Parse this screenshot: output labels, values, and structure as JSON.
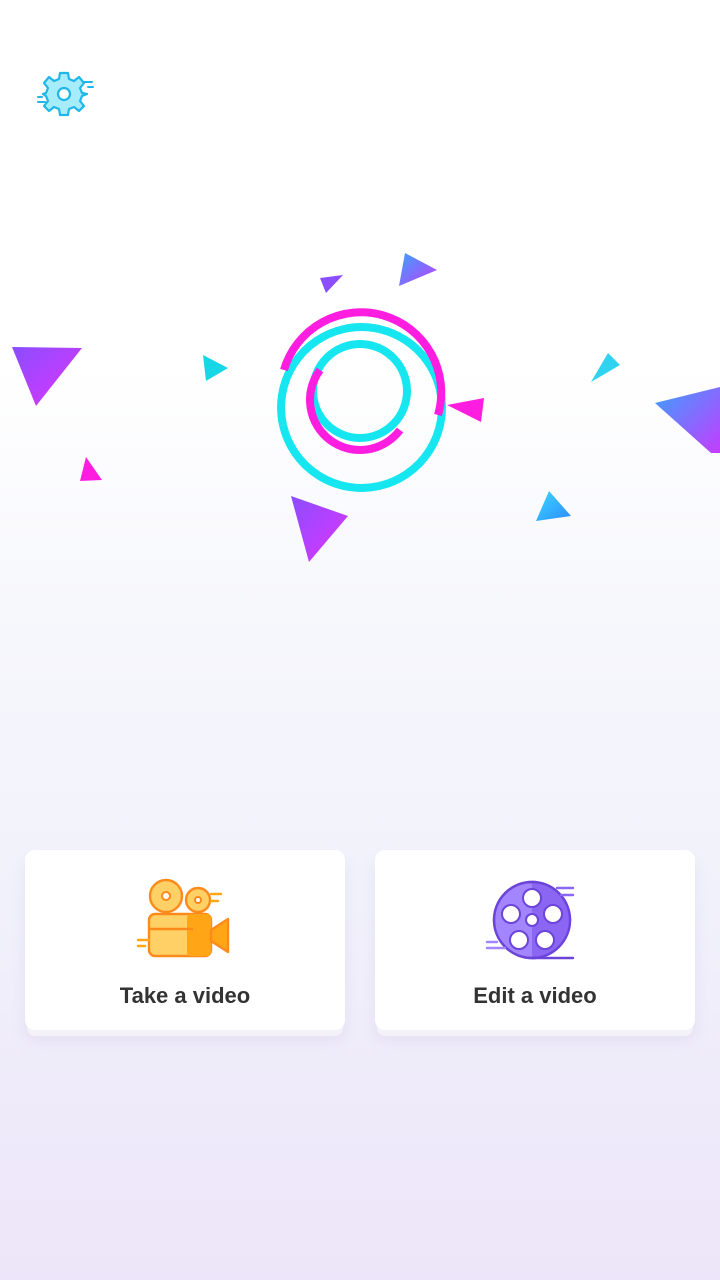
{
  "toolbar": {
    "settings_icon": "gear-icon"
  },
  "hero": {
    "logo_icon": "concentric-rings-logo",
    "colors": {
      "magenta": "#ff1ee0",
      "cyan": "#16e6ef",
      "violet": "#8a4dff"
    }
  },
  "actions": {
    "take_video": {
      "label": "Take a video",
      "icon": "video-camera-icon",
      "accent": "#ffa516"
    },
    "edit_video": {
      "label": "Edit a video",
      "icon": "film-reel-icon",
      "accent": "#7a52e6"
    }
  }
}
